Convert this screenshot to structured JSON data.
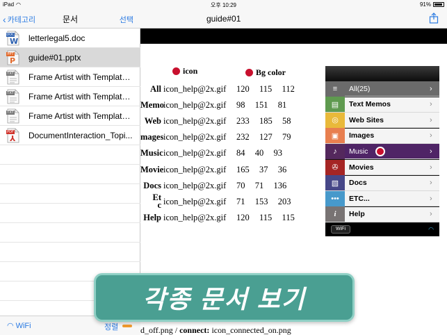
{
  "status_bar": {
    "device": "iPad",
    "time": "오후 10:29",
    "battery": "91%",
    "battery_level": 0.91
  },
  "sidebar": {
    "back_label": "카테고리",
    "title": "문서",
    "select_label": "선택",
    "files": [
      {
        "name": "letterlegal5.doc",
        "type": "doc-icon",
        "selected": false
      },
      {
        "name": "guide#01.pptx",
        "type": "ppt-icon",
        "selected": true
      },
      {
        "name": "Frame Artist with Template...",
        "type": "txt-icon",
        "selected": false
      },
      {
        "name": "Frame Artist with Template...",
        "type": "txt-icon",
        "selected": false
      },
      {
        "name": "Frame Artist with Template...",
        "type": "txt-icon",
        "selected": false
      },
      {
        "name": "DocumentInteraction_Topi...",
        "type": "pdf-icon",
        "selected": false
      }
    ],
    "icon_badges": {
      "doc": "DOC",
      "ppt": "PPT",
      "txt": "TXT",
      "pdf": "PDF"
    },
    "wifi_label": "WiFi",
    "sort_label": "정렬"
  },
  "viewer": {
    "title": "guide#01",
    "headers": {
      "icon": "icon",
      "bg_color": "Bg color"
    },
    "rows": [
      {
        "category": "All",
        "icon_file": "icon_help@2x.gif",
        "rgb": "120  115  112"
      },
      {
        "category": "Memo",
        "icon_file": "icon_help@2x.gif",
        "rgb": "98  151  81"
      },
      {
        "category": "Web",
        "icon_file": "icon_help@2x.gif",
        "rgb": "233  185  58"
      },
      {
        "category": "mages",
        "icon_file": "icon_help@2x.gif",
        "rgb": "232  127  79"
      },
      {
        "category": "Music",
        "icon_file": "icon_help@2x.gif",
        "rgb": "84  40  93"
      },
      {
        "category": "Movie",
        "icon_file": "icon_help@2x.gif",
        "rgb": "165  37  36"
      },
      {
        "category": "Docs",
        "icon_file": "icon_help@2x.gif",
        "rgb": "70  71  136"
      },
      {
        "category": "Et\nc",
        "icon_file": "icon_help@2x.gif",
        "rgb": "71  153  203"
      },
      {
        "category": "Help",
        "icon_file": "icon_help@2x.gif",
        "rgb": "120  115  115"
      }
    ],
    "footer_prefix": "d_off.png / ",
    "footer_bold": "connect:",
    "footer_suffix": " icon_connected_on.png"
  },
  "menu": {
    "items": [
      {
        "label": "All(25)",
        "icon": "list-icon",
        "color": "#6b6b6b",
        "glyph": "≡"
      },
      {
        "label": "Text Memos",
        "icon": "memo-icon",
        "color": "#5f9a4f",
        "glyph": "▤"
      },
      {
        "label": "Web Sites",
        "icon": "compass-icon",
        "color": "#e9b93a",
        "glyph": "◎"
      },
      {
        "label": "Images",
        "icon": "image-icon",
        "color": "#e87f4f",
        "glyph": "▣"
      },
      {
        "label": "Music",
        "icon": "music-icon",
        "color": "#54285d",
        "glyph": "♪"
      },
      {
        "label": "Movies",
        "icon": "film-icon",
        "color": "#a52524",
        "glyph": "✇"
      },
      {
        "label": "Docs",
        "icon": "docs-icon",
        "color": "#464788",
        "glyph": "▧"
      },
      {
        "label": "ETC...",
        "icon": "more-icon",
        "color": "#4799cb",
        "glyph": "•••"
      },
      {
        "label": "Help",
        "icon": "info-icon",
        "color": "#787373",
        "glyph": "i"
      }
    ],
    "wifi_chip": "WiFi"
  },
  "banner": {
    "text": "각종 문서 보기",
    "color": "#4a9f92"
  }
}
